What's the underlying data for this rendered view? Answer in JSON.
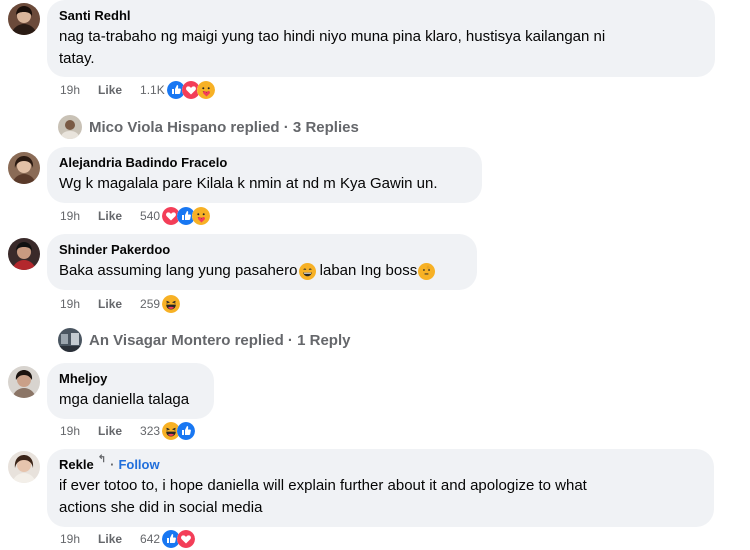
{
  "comments": [
    {
      "author": "Santi Redhl",
      "text_line1": "nag ta-trabaho ng maigi yung tao hindi niyo muna pina klaro, hustisya kailangan ni",
      "text_line2": "tatay.",
      "time": "19h",
      "like_label": "Like",
      "reaction_count": "1.1K",
      "reactions": [
        "like-reaction",
        "love-reaction",
        "care-reaction"
      ]
    },
    {
      "author": "Alejandria Badindo Fracelo",
      "text": "Wg k magalala pare Kilala k nmin at nd m Kya Gawin un.",
      "time": "19h",
      "like_label": "Like",
      "reaction_count": "540",
      "reactions": [
        "love-reaction",
        "like-reaction",
        "care-reaction"
      ]
    },
    {
      "author": "Shinder Pakerdoo",
      "text": "Baka assuming lang yung pasahero",
      "text_tail": " laban Ing boss",
      "time": "19h",
      "like_label": "Like",
      "reaction_count": "259",
      "reactions": [
        "haha-reaction"
      ]
    },
    {
      "author": "Mheljoy",
      "text": "mga daniella talaga",
      "time": "19h",
      "like_label": "Like",
      "reaction_count": "323",
      "reactions": [
        "haha-reaction",
        "like-reaction"
      ]
    },
    {
      "author": "Rekle",
      "follow_separator": "·",
      "follow_label": "Follow",
      "text_line1": "if ever totoo to, i hope daniella will explain further about it and apologize to what",
      "text_line2": "actions she did in social media",
      "time": "19h",
      "like_label": "Like",
      "reaction_count": "642",
      "reactions": [
        "like-reaction",
        "love-reaction"
      ]
    }
  ],
  "reply_threads": [
    {
      "label": "Mico Viola Hispano replied · 3 Replies"
    },
    {
      "label": "An Visagar Montero replied · 1 Reply"
    }
  ],
  "colors": {
    "bubble": "#f0f2f5",
    "meta_text": "#65676b",
    "follow": "#216fdb",
    "like_blue": "#1877f2",
    "love_red": "#f33e58",
    "haha_yellow": "#f7b125"
  }
}
